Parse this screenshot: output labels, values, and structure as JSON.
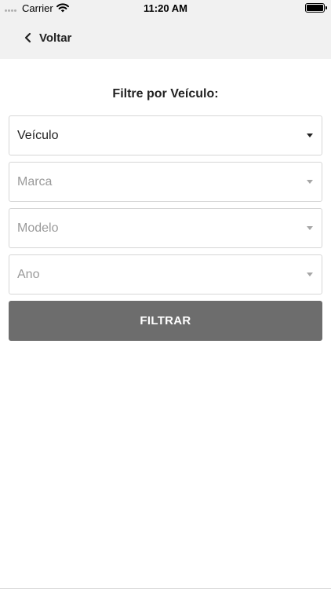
{
  "status_bar": {
    "carrier": "Carrier",
    "time": "11:20 AM",
    "battery_level": 1.0
  },
  "nav": {
    "back_label": "Voltar",
    "back_icon": "chevron-left-icon"
  },
  "filter": {
    "title": "Filtre por Veículo:",
    "selects": [
      {
        "label": "Veículo",
        "enabled": true
      },
      {
        "label": "Marca",
        "enabled": false
      },
      {
        "label": "Modelo",
        "enabled": false
      },
      {
        "label": "Ano",
        "enabled": false
      }
    ],
    "button_label": "FILTRAR"
  },
  "colors": {
    "bar_background": "#f1f1f1",
    "button_background": "#6d6d6d",
    "disabled_text": "#9a9a9a"
  }
}
